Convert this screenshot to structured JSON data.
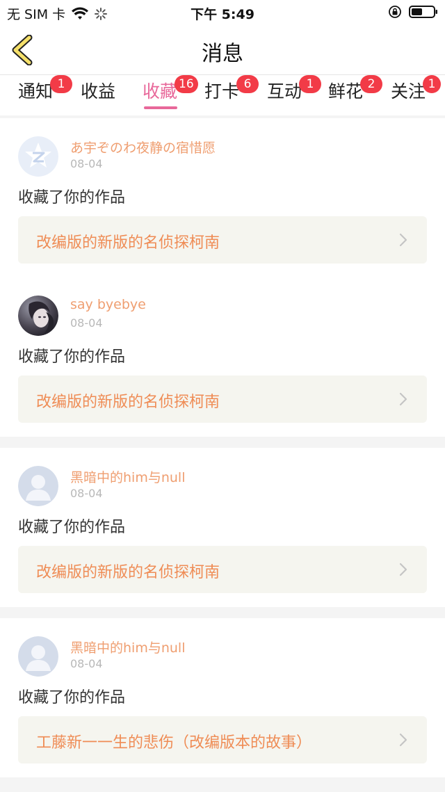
{
  "status_bar": {
    "carrier": "无 SIM 卡",
    "time": "下午 5:49",
    "icons": [
      "wifi-icon",
      "loading-spinner-icon",
      "orientation-lock-icon",
      "battery-icon"
    ]
  },
  "nav": {
    "back_icon": "chevron-left-icon",
    "title": "消息"
  },
  "tabs": [
    {
      "label": "通知",
      "badge": "1"
    },
    {
      "label": "收益",
      "badge": ""
    },
    {
      "label": "收藏",
      "badge": "16",
      "active": true
    },
    {
      "label": "打卡",
      "badge": "6"
    },
    {
      "label": "互动",
      "badge": "1"
    },
    {
      "label": "鲜花",
      "badge": "2"
    },
    {
      "label": "关注",
      "badge": "1"
    }
  ],
  "notifications": [
    {
      "avatar": "qq-default-avatar",
      "username": "あ宇ぞのわ夜静の宿惜愿",
      "date": "08-04",
      "action": "收藏了你的作品",
      "work_title": "改编版的新版的名侦探柯南"
    },
    {
      "avatar": "photo-avatar",
      "username": "say byebye",
      "date": "08-04",
      "action": "收藏了你的作品",
      "work_title": "改编版的新版的名侦探柯南"
    },
    {
      "avatar": "default-person-avatar",
      "username": "黑暗中的him与null",
      "date": "08-04",
      "action": "收藏了你的作品",
      "work_title": "改编版的新版的名侦探柯南"
    },
    {
      "avatar": "default-person-avatar",
      "username": "黑暗中的him与null",
      "date": "08-04",
      "action": "收藏了你的作品",
      "work_title": "工藤新一一生的悲伤（改编版本的故事）"
    }
  ],
  "colors": {
    "accent_pink": "#e8689a",
    "badge_red": "#f23b47",
    "username_orange": "#ef9e70",
    "work_title_orange": "#ef8c55",
    "work_box_bg": "#f5f5ef",
    "back_icon_yellow": "#f5e06a"
  }
}
